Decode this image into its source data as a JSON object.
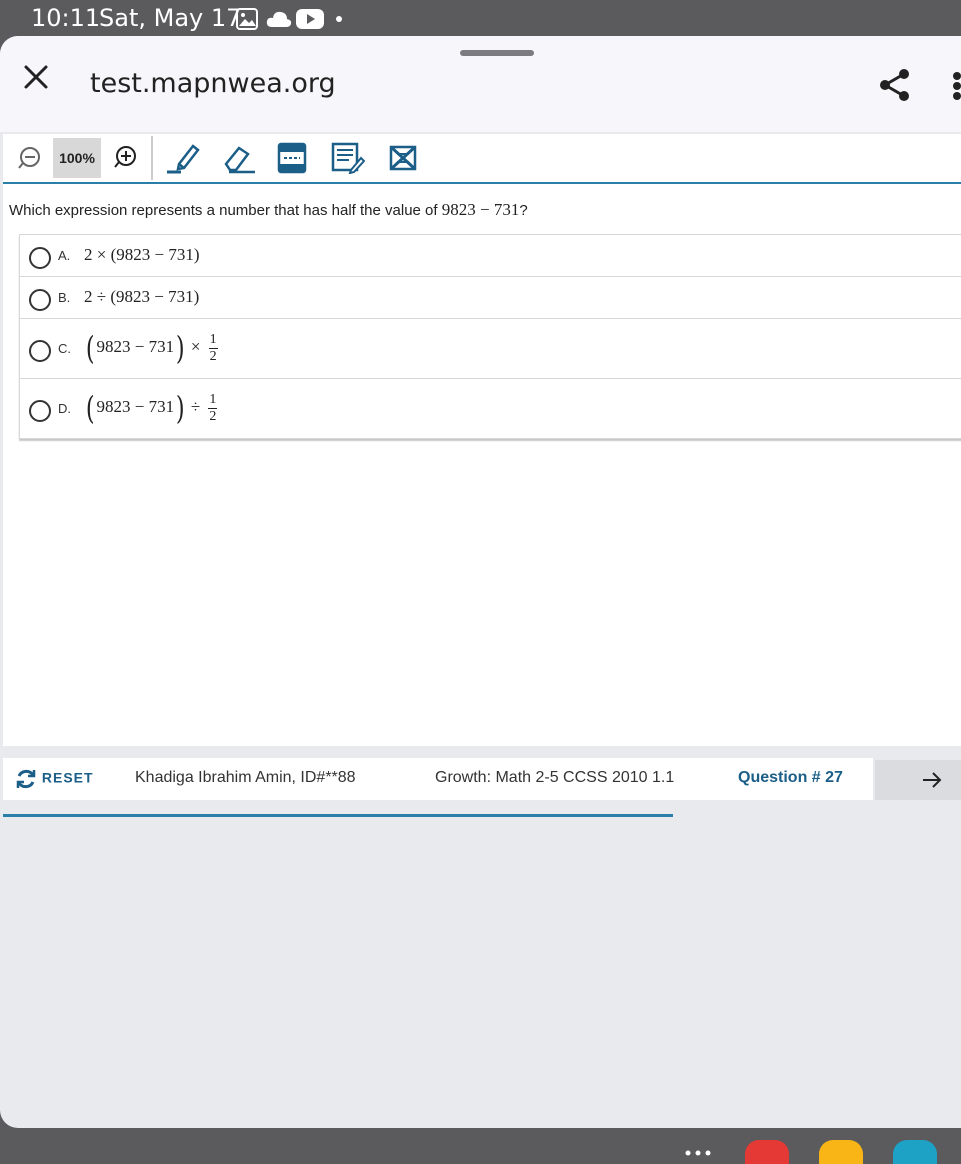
{
  "status_bar": {
    "time": "10:11",
    "date": "Sat, May 17"
  },
  "browser": {
    "url": "test.mapnwea.org"
  },
  "toolbar": {
    "zoom": "100%"
  },
  "question": {
    "prompt": "Which expression represents a number that has half the value of",
    "prompt_math": "9823 − 731",
    "prompt_end": "?"
  },
  "choices": [
    {
      "letter": "A.",
      "expr_main": "2 × (9823 − 731)"
    },
    {
      "letter": "B.",
      "expr_main": "2 ÷ (9823 − 731)"
    },
    {
      "letter": "C.",
      "expr_inner": "9823 − 731",
      "operator": "×",
      "frac_num": "1",
      "frac_den": "2"
    },
    {
      "letter": "D.",
      "expr_inner": "9823 − 731",
      "operator": "÷",
      "frac_num": "1",
      "frac_den": "2"
    }
  ],
  "footer": {
    "reset_label": "RESET",
    "student": "Khadiga Ibrahim Amin, ID#**88",
    "test_name": "Growth: Math 2-5 CCSS 2010 1.1",
    "question_number": "Question # 27"
  },
  "colors": {
    "accent": "#2a7fa8",
    "link": "#1b5e88"
  }
}
